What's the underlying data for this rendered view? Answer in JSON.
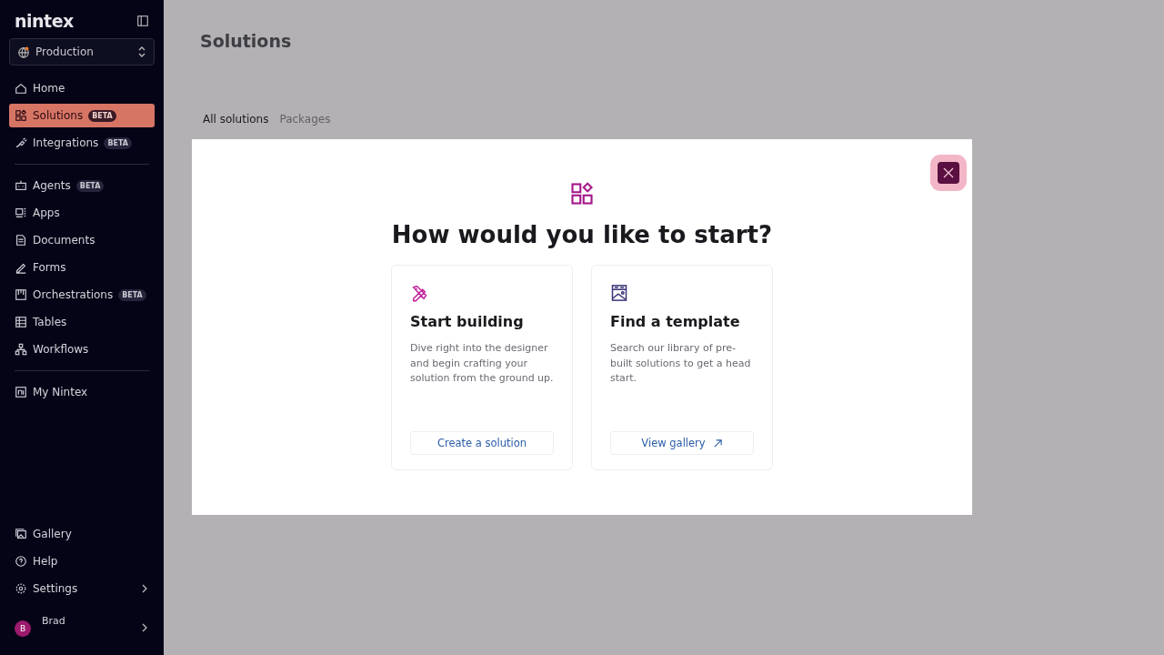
{
  "sidebar": {
    "logo": "nintex",
    "environment": "Production",
    "groups": [
      [
        {
          "label": "Home",
          "selected": false
        },
        {
          "label": "Solutions",
          "badge": "BETA",
          "selected": true
        },
        {
          "label": "Integrations",
          "badge": "BETA",
          "selected": false
        }
      ],
      [
        {
          "label": "Agents",
          "badge": "BETA",
          "selected": false
        },
        {
          "label": "Apps",
          "selected": false
        },
        {
          "label": "Documents",
          "selected": false
        },
        {
          "label": "Forms",
          "selected": false
        },
        {
          "label": "Orchestrations",
          "badge": "BETA",
          "selected": false
        },
        {
          "label": "Tables",
          "selected": false
        },
        {
          "label": "Workflows",
          "selected": false
        }
      ],
      [
        {
          "label": "My Nintex",
          "selected": false
        }
      ]
    ],
    "bottom_items": [
      {
        "label": "Gallery",
        "expandable": false
      },
      {
        "label": "Help",
        "expandable": false
      },
      {
        "label": "Settings",
        "expandable": true
      }
    ],
    "user": {
      "initial": "B",
      "name": "Brad"
    }
  },
  "page": {
    "title": "Solutions",
    "tabs": [
      {
        "label": "All solutions",
        "selected": true
      },
      {
        "label": "Packages",
        "selected": false
      }
    ]
  },
  "dialog": {
    "title": "How would you like to start?",
    "options": [
      {
        "kind": "build",
        "title": "Start building",
        "description": "Dive right into the designer and begin crafting your solution from the ground up.",
        "action": "Create a solution",
        "external": false
      },
      {
        "kind": "template",
        "title": "Find a template",
        "description": "Search our library of pre-built solutions to get a head start.",
        "action": "View gallery",
        "external": true
      }
    ]
  }
}
